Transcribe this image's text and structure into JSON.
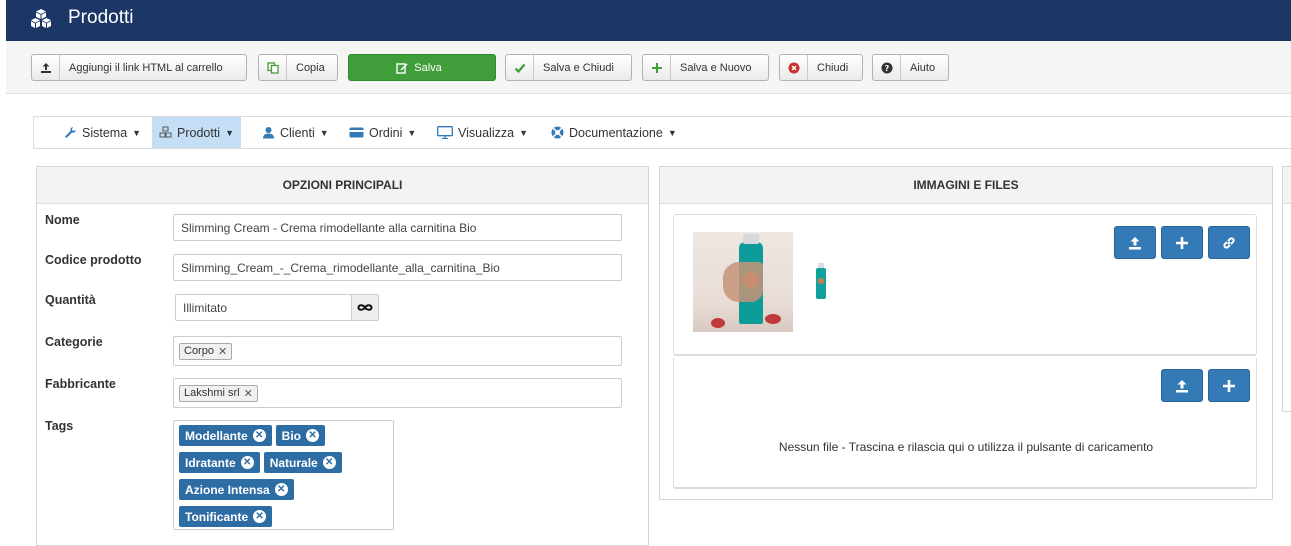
{
  "header": {
    "title": "Prodotti"
  },
  "toolbar": {
    "add_link": "Aggiungi il link HTML al carrello",
    "copy": "Copia",
    "save": "Salva",
    "save_close": "Salva e Chiudi",
    "save_new": "Salva e Nuovo",
    "close": "Chiudi",
    "help": "Aiuto"
  },
  "menu": [
    {
      "label": "Sistema"
    },
    {
      "label": "Prodotti"
    },
    {
      "label": "Clienti"
    },
    {
      "label": "Ordini"
    },
    {
      "label": "Visualizza"
    },
    {
      "label": "Documentazione"
    }
  ],
  "options": {
    "title": "OPZIONI PRINCIPALI",
    "name_label": "Nome",
    "name_value": "Slimming Cream - Crema rimodellante alla carnitina Bio",
    "code_label": "Codice prodotto",
    "code_value": "Slimming_Cream_-_Crema_rimodellante_alla_carnitina_Bio",
    "qty_label": "Quantità",
    "qty_value": "Illimitato",
    "cat_label": "Categorie",
    "cat_value": "Corpo",
    "mfr_label": "Fabbricante",
    "mfr_value": "Lakshmi srl",
    "tags_label": "Tags",
    "tags": [
      "Modellante",
      "Bio",
      "Idratante",
      "Naturale",
      "Azione Intensa",
      "Tonificante"
    ]
  },
  "images": {
    "title": "IMMAGINI E FILES",
    "no_file": "Nessun file - Trascina e rilascia qui o utilizza il pulsante di caricamento"
  },
  "colors": {
    "header": "#1c3766",
    "save": "#3f9d3a",
    "primary": "#337ab7",
    "active_menu": "#c4def5"
  }
}
